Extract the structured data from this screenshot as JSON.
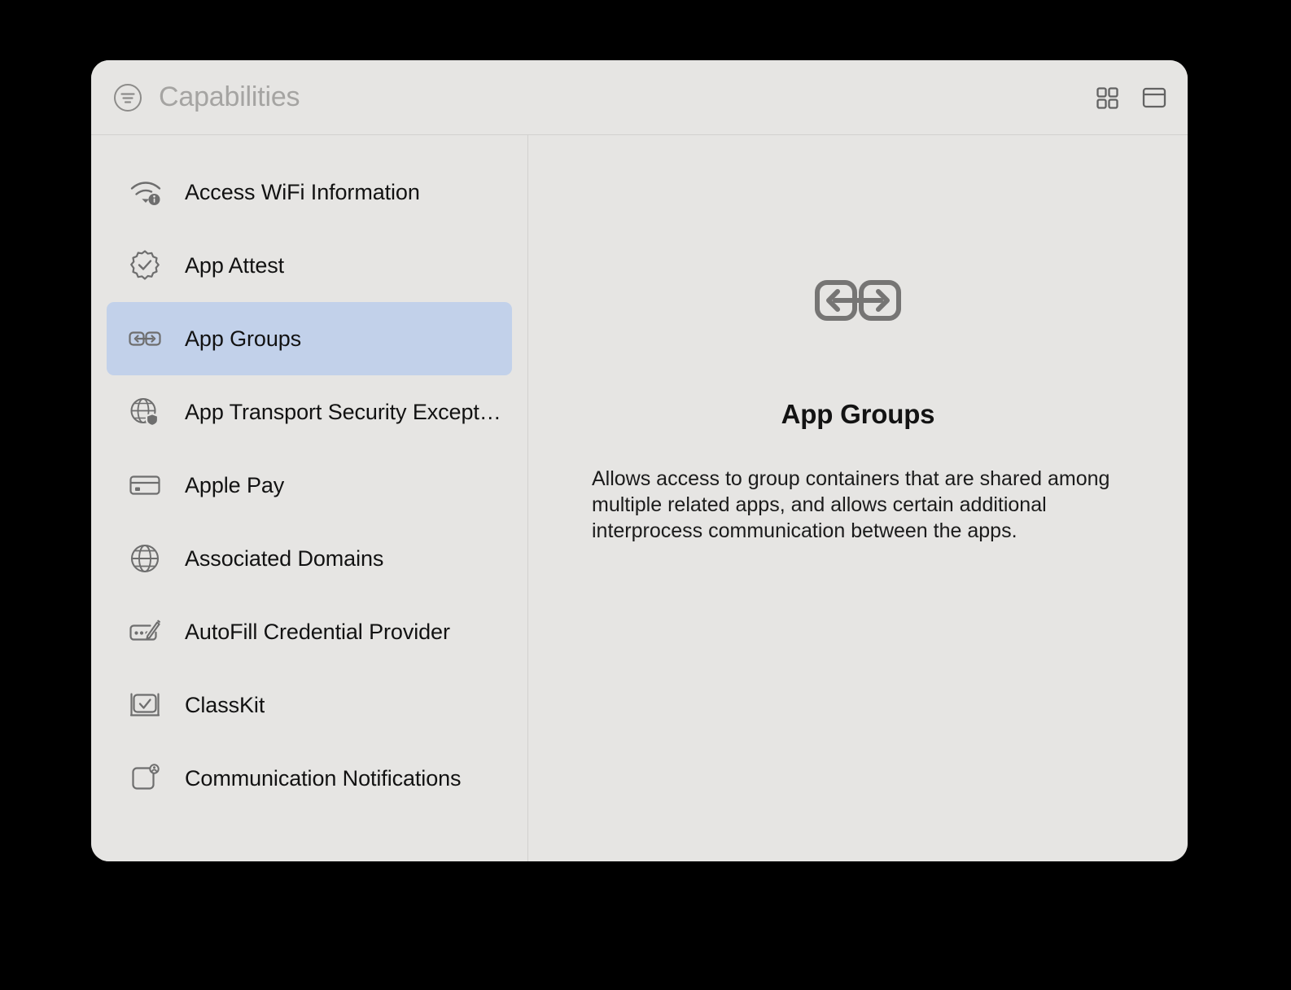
{
  "window": {
    "title": "Capabilities",
    "filter_icon": "filter-circle-icon",
    "toolbar": {
      "grid_view_label": "grid-view-icon",
      "panel_view_label": "panel-view-icon"
    }
  },
  "colors": {
    "backdrop": "#000000",
    "window_background": "#e6e5e3",
    "divider": "#d2d1cf",
    "selection": "#c2d1ea",
    "title_text": "#a5a4a2",
    "body_text": "#121212",
    "icon_stroke": "#6e6e6e"
  },
  "sidebar": {
    "items": [
      {
        "label": "Access WiFi Information",
        "icon": "wifi-info-icon",
        "selected": false
      },
      {
        "label": "App Attest",
        "icon": "seal-checkmark-icon",
        "selected": false
      },
      {
        "label": "App Groups",
        "icon": "app-groups-icon",
        "selected": true
      },
      {
        "label": "App Transport Security Excepti…",
        "icon": "globe-shield-icon",
        "selected": false
      },
      {
        "label": "Apple Pay",
        "icon": "credit-card-icon",
        "selected": false
      },
      {
        "label": "Associated Domains",
        "icon": "globe-icon",
        "selected": false
      },
      {
        "label": "AutoFill Credential Provider",
        "icon": "autofill-pencil-icon",
        "selected": false
      },
      {
        "label": "ClassKit",
        "icon": "whiteboard-check-icon",
        "selected": false
      },
      {
        "label": "Communication Notifications",
        "icon": "communication-badge-icon",
        "selected": false
      }
    ]
  },
  "detail": {
    "icon": "app-groups-icon",
    "title": "App Groups",
    "description": "Allows access to group containers that are shared among multiple related apps, and allows certain additional interprocess communication between the apps."
  }
}
